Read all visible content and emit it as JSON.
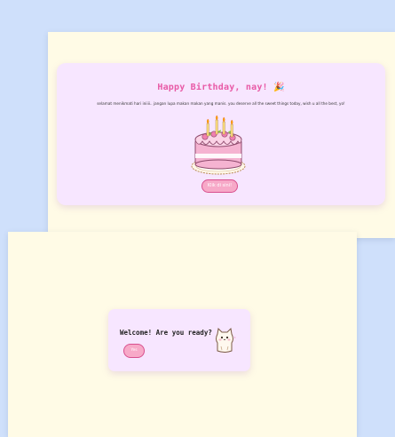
{
  "birthday": {
    "title": "Happy Birthday, nay!",
    "title_icon": "party-popper-icon",
    "message": "selamat menikmati hari iniiii.. jangan lupa makan makan yang manis. you deserve all the sweet things today, wish u all the best, yo!",
    "button_label": "Klik di sini!",
    "cake_icon": "birthday-cake-icon"
  },
  "welcome": {
    "prompt": "Welcome! Are you ready?",
    "yes_label": "Yes",
    "cat_icon": "cat-icon"
  },
  "colors": {
    "page_bg": "#cfe0fb",
    "panel_bg": "#fffbe6",
    "card_bg": "#f7e6ff",
    "title": "#e85aa6",
    "button_fill": "#f7a9c8",
    "button_border": "#d84f8e"
  }
}
